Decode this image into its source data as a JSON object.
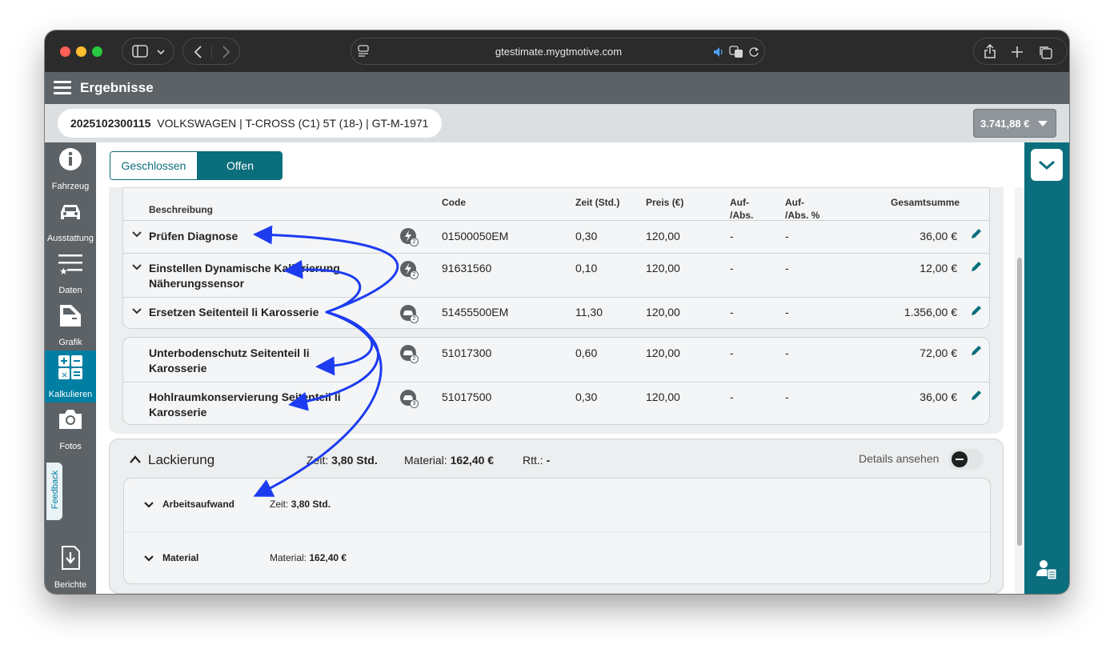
{
  "browser": {
    "url": "gtestimate.mygtmotive.com"
  },
  "app": {
    "title": "Ergebnisse",
    "vehicle_id": "2025102300115",
    "vehicle_desc": "VOLKSWAGEN | T-CROSS (C1) 5T (18-) | GT-M-1971",
    "total": "3.741,88 €"
  },
  "nav": [
    {
      "label": "Fahrzeug",
      "icon": "info-icon"
    },
    {
      "label": "Ausstattung",
      "icon": "car-icon"
    },
    {
      "label": "Daten",
      "icon": "list-star-icon"
    },
    {
      "label": "Grafik",
      "icon": "car-door-icon"
    },
    {
      "label": "Kalkulieren",
      "icon": "calculator-icon"
    },
    {
      "label": "Fotos",
      "icon": "camera-icon"
    },
    {
      "label": "Berichte",
      "icon": "download-report-icon"
    }
  ],
  "feedback_label": "Feedback",
  "tabs": {
    "closed": "Geschlossen",
    "open": "Offen",
    "active": "Offen"
  },
  "table": {
    "headers": {
      "desc": "Beschreibung",
      "code": "Code",
      "time": "Zeit (Std.)",
      "price": "Preis (€)",
      "surcharge": "Auf-\n/Abs.",
      "surcharge_pct": "Auf-\n/Abs. %",
      "total": "Gesamtsumme"
    },
    "rows": [
      {
        "desc": "Prüfen Diagnose",
        "badge": "2",
        "code": "01500050EM",
        "time": "0,30",
        "price": "120,00",
        "sur": "-",
        "sur_pct": "-",
        "total": "36,00 €"
      },
      {
        "desc": "Einstellen Dynamische Kalibrierung Näherungssensor",
        "badge": "2",
        "code": "91631560",
        "time": "0,10",
        "price": "120,00",
        "sur": "-",
        "sur_pct": "-",
        "total": "12,00 €"
      },
      {
        "desc": "Ersetzen Seitenteil li Karosserie",
        "badge": "2",
        "code": "51455500EM",
        "time": "11,30",
        "price": "120,00",
        "sur": "-",
        "sur_pct": "-",
        "total": "1.356,00 €"
      },
      {
        "desc": "Unterbodenschutz Seitenteil li Karosserie",
        "badge": "2",
        "code": "51017300",
        "time": "0,60",
        "price": "120,00",
        "sur": "-",
        "sur_pct": "-",
        "total": "72,00 €"
      },
      {
        "desc": "Hohlraumkonservierung Seitenteil li Karosserie",
        "badge": "3",
        "code": "51017500",
        "time": "0,30",
        "price": "120,00",
        "sur": "-",
        "sur_pct": "-",
        "total": "36,00 €"
      }
    ]
  },
  "lackierung": {
    "title": "Lackierung",
    "zeit_label": "Zeit:",
    "zeit_value": "3,80 Std.",
    "material_label": "Material:",
    "material_value": "162,40 €",
    "rtt_label": "Rtt.:",
    "rtt_value": "-",
    "details_label": "Details ansehen",
    "sub": [
      {
        "label": "Arbeitsaufwand",
        "meta_label": "Zeit:",
        "meta_value": "3,80 Std."
      },
      {
        "label": "Material",
        "meta_label": "Material:",
        "meta_value": "162,40 €"
      }
    ]
  },
  "colors": {
    "accent": "#0b6e7c",
    "active_nav": "#007fa3",
    "header": "#5c6266",
    "annotation_arrow": "#1d3cf0"
  }
}
